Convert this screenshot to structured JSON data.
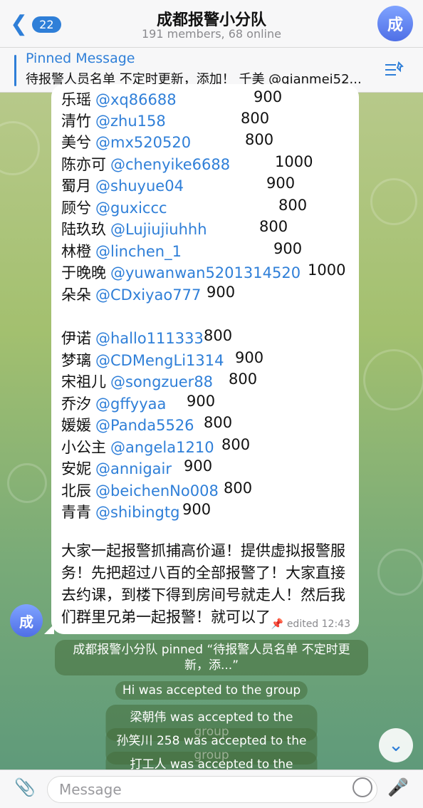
{
  "header": {
    "back_badge": "22",
    "title": "成都报警小分队",
    "subtitle": "191 members, 68 online",
    "avatar_letter": "成"
  },
  "pinned": {
    "title": "Pinned Message",
    "text": "待报警人员名单 不定时更新，添加！ 千美 @qianmei52..."
  },
  "message": {
    "rows": [
      {
        "name": "乐瑶",
        "handle": "@xq86688",
        "amount": "900"
      },
      {
        "name": "清竹",
        "handle": "@zhu158",
        "amount": "800"
      },
      {
        "name": "美兮",
        "handle": "@mx520520",
        "amount": "800"
      },
      {
        "name": "陈亦可",
        "handle": "@chenyike6688",
        "amount": "1000"
      },
      {
        "name": "蜀月",
        "handle": "@shuyue04",
        "amount": "900"
      },
      {
        "name": "顾兮",
        "handle": "@guxiccc",
        "amount": "800"
      },
      {
        "name": "陆玖玖",
        "handle": "@Lujiujiuhhh",
        "amount": "800"
      },
      {
        "name": "林橙",
        "handle": "@linchen_1",
        "amount": "900"
      },
      {
        "name": "于晚晚",
        "handle": "@yuwanwan5201314520",
        "amount": "1000"
      },
      {
        "name": "朵朵",
        "handle": "@CDxiyao777",
        "amount": "900"
      },
      {
        "name": "伊诺",
        "handle": "@hallo111333",
        "amount": "800"
      },
      {
        "name": "梦璃",
        "handle": "@CDMengLi1314",
        "amount": "900"
      },
      {
        "name": "宋祖儿",
        "handle": "@songzuer88",
        "amount": "800"
      },
      {
        "name": "乔汐",
        "handle": "@gffyyaa",
        "amount": "900"
      },
      {
        "name": "媛媛",
        "handle": "@Panda5526",
        "amount": "800"
      },
      {
        "name": "小公主",
        "handle": "@angela1210",
        "amount": "800"
      },
      {
        "name": "安妮",
        "handle": "@annigair",
        "amount": "900"
      },
      {
        "name": "北辰",
        "handle": "@beichenNo008",
        "amount": "800"
      },
      {
        "name": "青青",
        "handle": "@shibingtg",
        "amount": "900"
      }
    ],
    "paragraph": "大家一起报警抓捕高价逼！提供虚拟报警服务！先把超过八百的全部报警了！大家直接去约课，到楼下得到房间号就走人！然后我们群里兄弟一起报警！就可以了",
    "meta": "edited 12:43",
    "sender_avatar_letter": "成"
  },
  "service": {
    "pinned_line1": "成都报警小分队 pinned “待报警人员名单 不定时更",
    "pinned_line2": "新，添...”",
    "accepted": [
      {
        "name": "Hi",
        "suffix": "was accepted to the group"
      },
      {
        "name": "梁朝伟",
        "suffix": "was accepted to the group"
      },
      {
        "name": "孙笑川 258",
        "suffix": "was accepted to the group"
      },
      {
        "name": "打工人",
        "suffix": "was accepted to the group"
      }
    ]
  },
  "input": {
    "placeholder": "Message"
  }
}
